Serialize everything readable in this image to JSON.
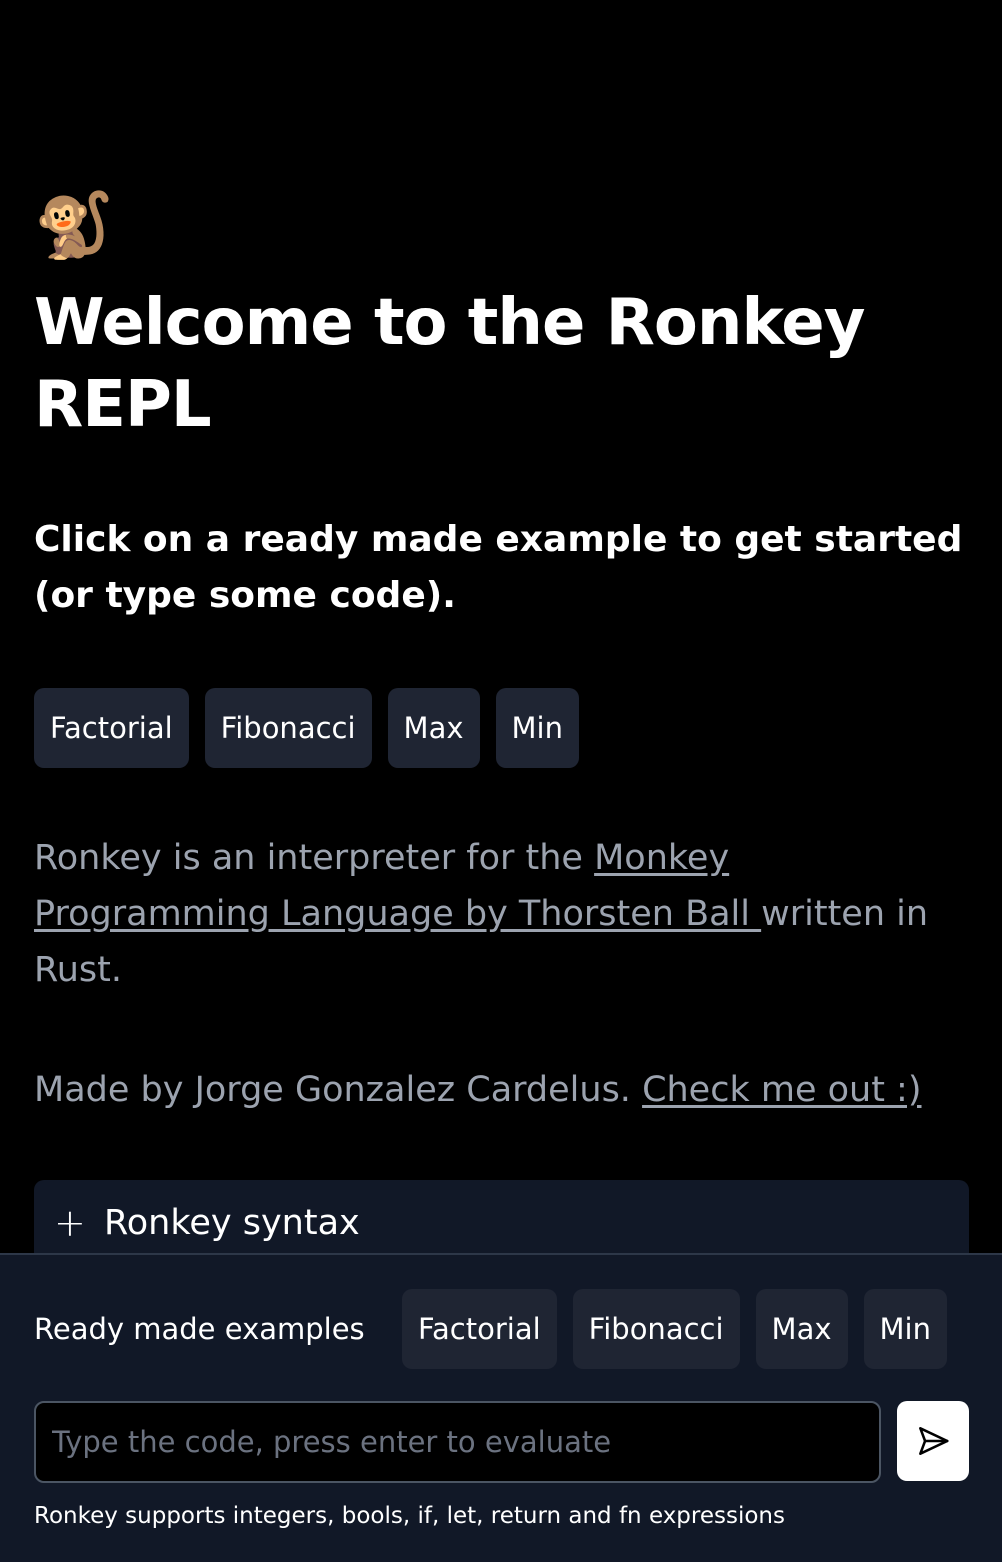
{
  "header": {
    "logo_icon": "monkey-emoji",
    "logo_glyph": "🐒",
    "title": "Welcome to the Ronkey REPL",
    "subtitle": "Click on a ready made example to get started (or type some code)."
  },
  "examples": [
    {
      "label": "Factorial"
    },
    {
      "label": "Fibonacci"
    },
    {
      "label": "Max"
    },
    {
      "label": "Min"
    }
  ],
  "description": {
    "prefix": "Ronkey is an interpreter for the ",
    "link_text": "Monkey Programming Language by Thorsten Ball ",
    "suffix": "written in Rust."
  },
  "credit": {
    "text": "Made by Jorge Gonzalez Cardelus. ",
    "link_text": "Check me out :)"
  },
  "accordion": {
    "icon": "plus-icon",
    "glyph": "+",
    "label": "Ronkey syntax"
  },
  "bottom_bar": {
    "label": "Ready made examples",
    "examples": [
      {
        "label": "Factorial"
      },
      {
        "label": "Fibonacci"
      },
      {
        "label": "Max"
      },
      {
        "label": "Min"
      }
    ],
    "input": {
      "value": "",
      "placeholder": "Type the code, press enter to evaluate"
    },
    "send_icon": "send-icon",
    "hint": "Ronkey supports integers, bools, if, let, return and fn expressions"
  },
  "colors": {
    "background": "#000000",
    "panel": "#111827",
    "chip": "#1f2533",
    "muted_text": "#9ca3af"
  }
}
